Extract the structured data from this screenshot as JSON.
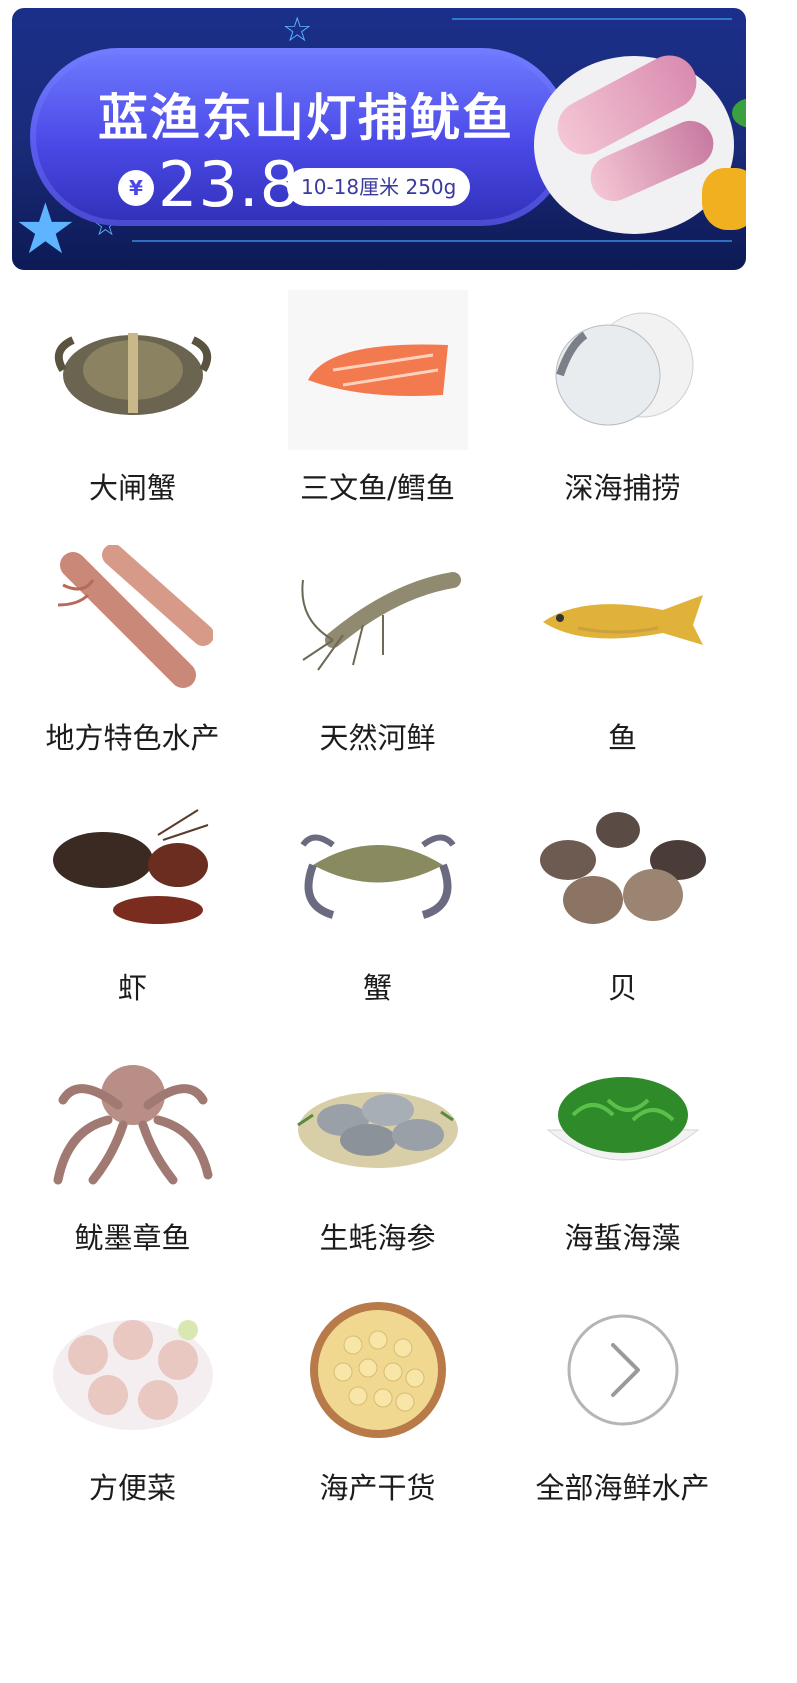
{
  "banner": {
    "title": "蓝渔东山灯捕鱿鱼",
    "currency": "¥",
    "price": "23.8",
    "spec": "10-18厘米 250g"
  },
  "categories": [
    {
      "label": "大闸蟹",
      "icon": "hairy-crab-icon"
    },
    {
      "label": "三文鱼/鳕鱼",
      "icon": "salmon-fillet-icon"
    },
    {
      "label": "深海捕捞",
      "icon": "cod-steak-icon"
    },
    {
      "label": "地方特色水产",
      "icon": "squid-icon"
    },
    {
      "label": "天然河鲜",
      "icon": "shrimp-icon"
    },
    {
      "label": "鱼",
      "icon": "yellow-croaker-icon"
    },
    {
      "label": "虾",
      "icon": "lobster-icon"
    },
    {
      "label": "蟹",
      "icon": "swimming-crab-icon"
    },
    {
      "label": "贝",
      "icon": "clams-icon"
    },
    {
      "label": "鱿墨章鱼",
      "icon": "octopus-icon"
    },
    {
      "label": "生蚝海参",
      "icon": "oysters-icon"
    },
    {
      "label": "海蜇海藻",
      "icon": "seaweed-salad-icon"
    },
    {
      "label": "方便菜",
      "icon": "scallop-dish-icon"
    },
    {
      "label": "海产干货",
      "icon": "dried-scallops-icon"
    },
    {
      "label": "全部海鲜水产",
      "icon": "chevron-right-circle-icon"
    }
  ]
}
